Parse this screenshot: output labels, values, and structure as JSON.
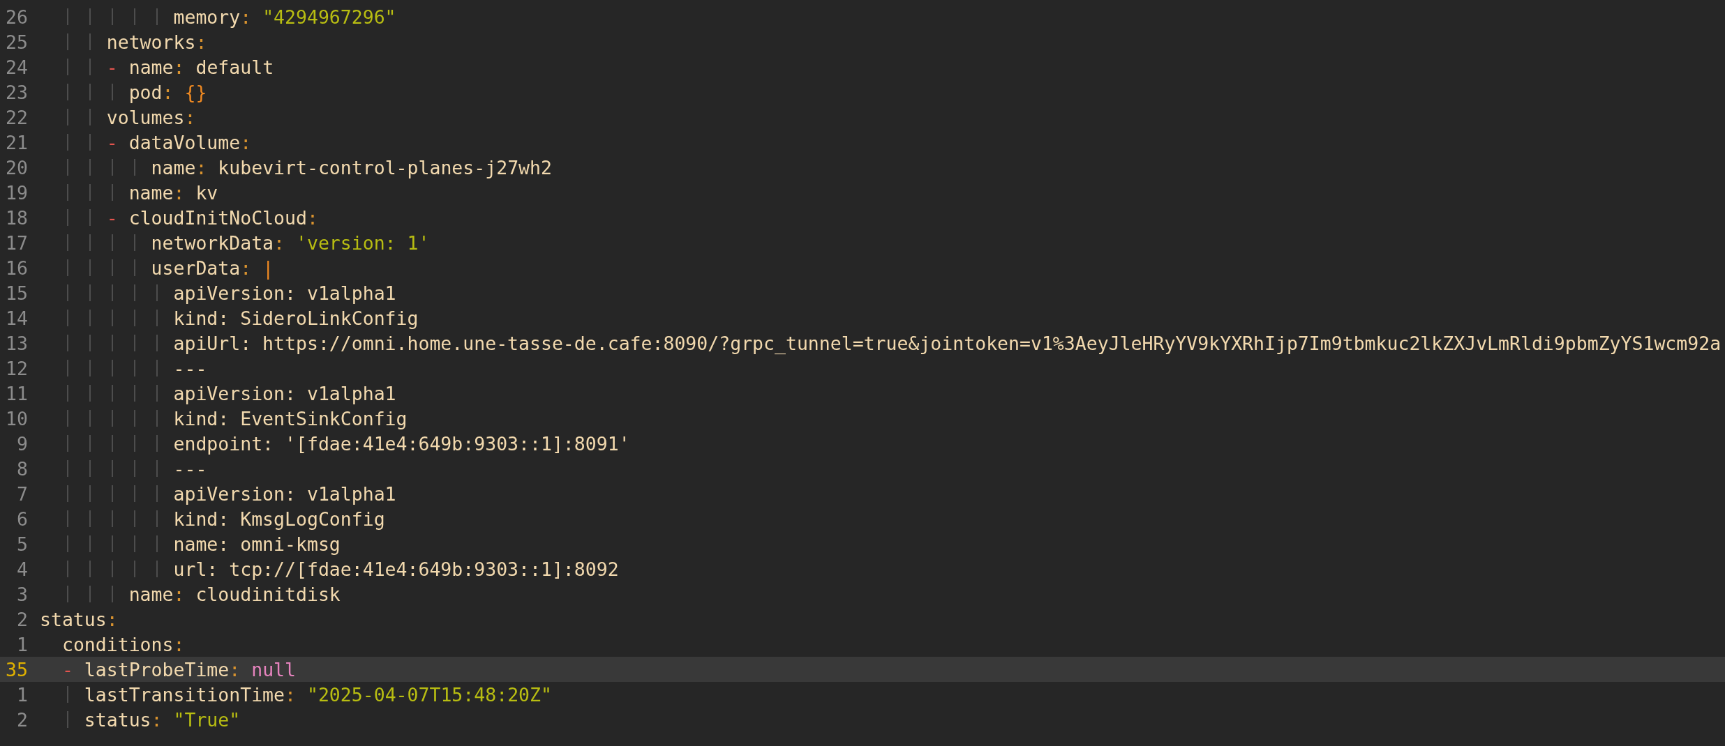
{
  "lines": [
    {
      "number": "26",
      "current": false,
      "tokens": [
        {
          "kind": "key",
          "text": "            memory"
        },
        {
          "kind": "colon",
          "text": ": "
        },
        {
          "kind": "string",
          "text": "\"4294967296\""
        }
      ]
    },
    {
      "number": "25",
      "current": false,
      "tokens": [
        {
          "kind": "key",
          "text": "      networks"
        },
        {
          "kind": "colon",
          "text": ":"
        }
      ]
    },
    {
      "number": "24",
      "current": false,
      "tokens": [
        {
          "kind": "dash",
          "text": "      - "
        },
        {
          "kind": "key",
          "text": "name"
        },
        {
          "kind": "colon",
          "text": ": "
        },
        {
          "kind": "text",
          "text": "default"
        }
      ]
    },
    {
      "number": "23",
      "current": false,
      "tokens": [
        {
          "kind": "key",
          "text": "        pod"
        },
        {
          "kind": "colon",
          "text": ": "
        },
        {
          "kind": "brace",
          "text": "{}"
        }
      ]
    },
    {
      "number": "22",
      "current": false,
      "tokens": [
        {
          "kind": "key",
          "text": "      volumes"
        },
        {
          "kind": "colon",
          "text": ":"
        }
      ]
    },
    {
      "number": "21",
      "current": false,
      "tokens": [
        {
          "kind": "dash",
          "text": "      - "
        },
        {
          "kind": "key",
          "text": "dataVolume"
        },
        {
          "kind": "colon",
          "text": ":"
        }
      ]
    },
    {
      "number": "20",
      "current": false,
      "tokens": [
        {
          "kind": "key",
          "text": "          name"
        },
        {
          "kind": "colon",
          "text": ": "
        },
        {
          "kind": "text",
          "text": "kubevirt-control-planes-j27wh2"
        }
      ]
    },
    {
      "number": "19",
      "current": false,
      "tokens": [
        {
          "kind": "key",
          "text": "        name"
        },
        {
          "kind": "colon",
          "text": ": "
        },
        {
          "kind": "text",
          "text": "kv"
        }
      ]
    },
    {
      "number": "18",
      "current": false,
      "tokens": [
        {
          "kind": "dash",
          "text": "      - "
        },
        {
          "kind": "key",
          "text": "cloudInitNoCloud"
        },
        {
          "kind": "colon",
          "text": ":"
        }
      ]
    },
    {
      "number": "17",
      "current": false,
      "tokens": [
        {
          "kind": "key",
          "text": "          networkData"
        },
        {
          "kind": "colon",
          "text": ": "
        },
        {
          "kind": "string",
          "text": "'version: 1'"
        }
      ]
    },
    {
      "number": "16",
      "current": false,
      "tokens": [
        {
          "kind": "key",
          "text": "          userData"
        },
        {
          "kind": "colon",
          "text": ": "
        },
        {
          "kind": "pipe",
          "text": "|"
        }
      ]
    },
    {
      "number": "15",
      "current": false,
      "tokens": [
        {
          "kind": "text",
          "text": "            apiVersion: v1alpha1"
        }
      ]
    },
    {
      "number": "14",
      "current": false,
      "tokens": [
        {
          "kind": "text",
          "text": "            kind: SideroLinkConfig"
        }
      ]
    },
    {
      "number": "13",
      "current": false,
      "tokens": [
        {
          "kind": "text",
          "text": "            apiUrl: https://omni.home.une-tasse-de.cafe:8090/?grpc_tunnel=true&jointoken=v1%3AeyJleHRyYV9kYXRhIjp7Im9tbmkuc2lkZXJvLmRldi9pbmZyYS1wcm92a"
        }
      ]
    },
    {
      "number": "12",
      "current": false,
      "tokens": [
        {
          "kind": "text",
          "text": "            ---"
        }
      ]
    },
    {
      "number": "11",
      "current": false,
      "tokens": [
        {
          "kind": "text",
          "text": "            apiVersion: v1alpha1"
        }
      ]
    },
    {
      "number": "10",
      "current": false,
      "tokens": [
        {
          "kind": "text",
          "text": "            kind: EventSinkConfig"
        }
      ]
    },
    {
      "number": "9",
      "current": false,
      "tokens": [
        {
          "kind": "text",
          "text": "            endpoint: '[fdae:41e4:649b:9303::1]:8091'"
        }
      ]
    },
    {
      "number": "8",
      "current": false,
      "tokens": [
        {
          "kind": "text",
          "text": "            ---"
        }
      ]
    },
    {
      "number": "7",
      "current": false,
      "tokens": [
        {
          "kind": "text",
          "text": "            apiVersion: v1alpha1"
        }
      ]
    },
    {
      "number": "6",
      "current": false,
      "tokens": [
        {
          "kind": "text",
          "text": "            kind: KmsgLogConfig"
        }
      ]
    },
    {
      "number": "5",
      "current": false,
      "tokens": [
        {
          "kind": "text",
          "text": "            name: omni-kmsg"
        }
      ]
    },
    {
      "number": "4",
      "current": false,
      "tokens": [
        {
          "kind": "text",
          "text": "            url: tcp://[fdae:41e4:649b:9303::1]:8092"
        }
      ]
    },
    {
      "number": "3",
      "current": false,
      "tokens": [
        {
          "kind": "key",
          "text": "        name"
        },
        {
          "kind": "colon",
          "text": ": "
        },
        {
          "kind": "text",
          "text": "cloudinitdisk"
        }
      ]
    },
    {
      "number": "2",
      "current": false,
      "tokens": [
        {
          "kind": "key",
          "text": "status"
        },
        {
          "kind": "colon",
          "text": ":"
        }
      ]
    },
    {
      "number": "1",
      "current": false,
      "tokens": [
        {
          "kind": "key",
          "text": "  conditions"
        },
        {
          "kind": "colon",
          "text": ":"
        }
      ]
    },
    {
      "number": "35",
      "current": true,
      "tokens": [
        {
          "kind": "dash",
          "text": "  - "
        },
        {
          "kind": "key",
          "text": "lastProbeTime"
        },
        {
          "kind": "colon",
          "text": ": "
        },
        {
          "kind": "null",
          "text": "null"
        }
      ]
    },
    {
      "number": "1",
      "current": false,
      "tokens": [
        {
          "kind": "key",
          "text": "    lastTransitionTime"
        },
        {
          "kind": "colon",
          "text": ": "
        },
        {
          "kind": "string",
          "text": "\"2025-04-07T15:48:20Z\""
        }
      ]
    },
    {
      "number": "2",
      "current": false,
      "tokens": [
        {
          "kind": "key",
          "text": "    status"
        },
        {
          "kind": "colon",
          "text": ": "
        },
        {
          "kind": "string",
          "text": "\"True\""
        }
      ]
    }
  ]
}
